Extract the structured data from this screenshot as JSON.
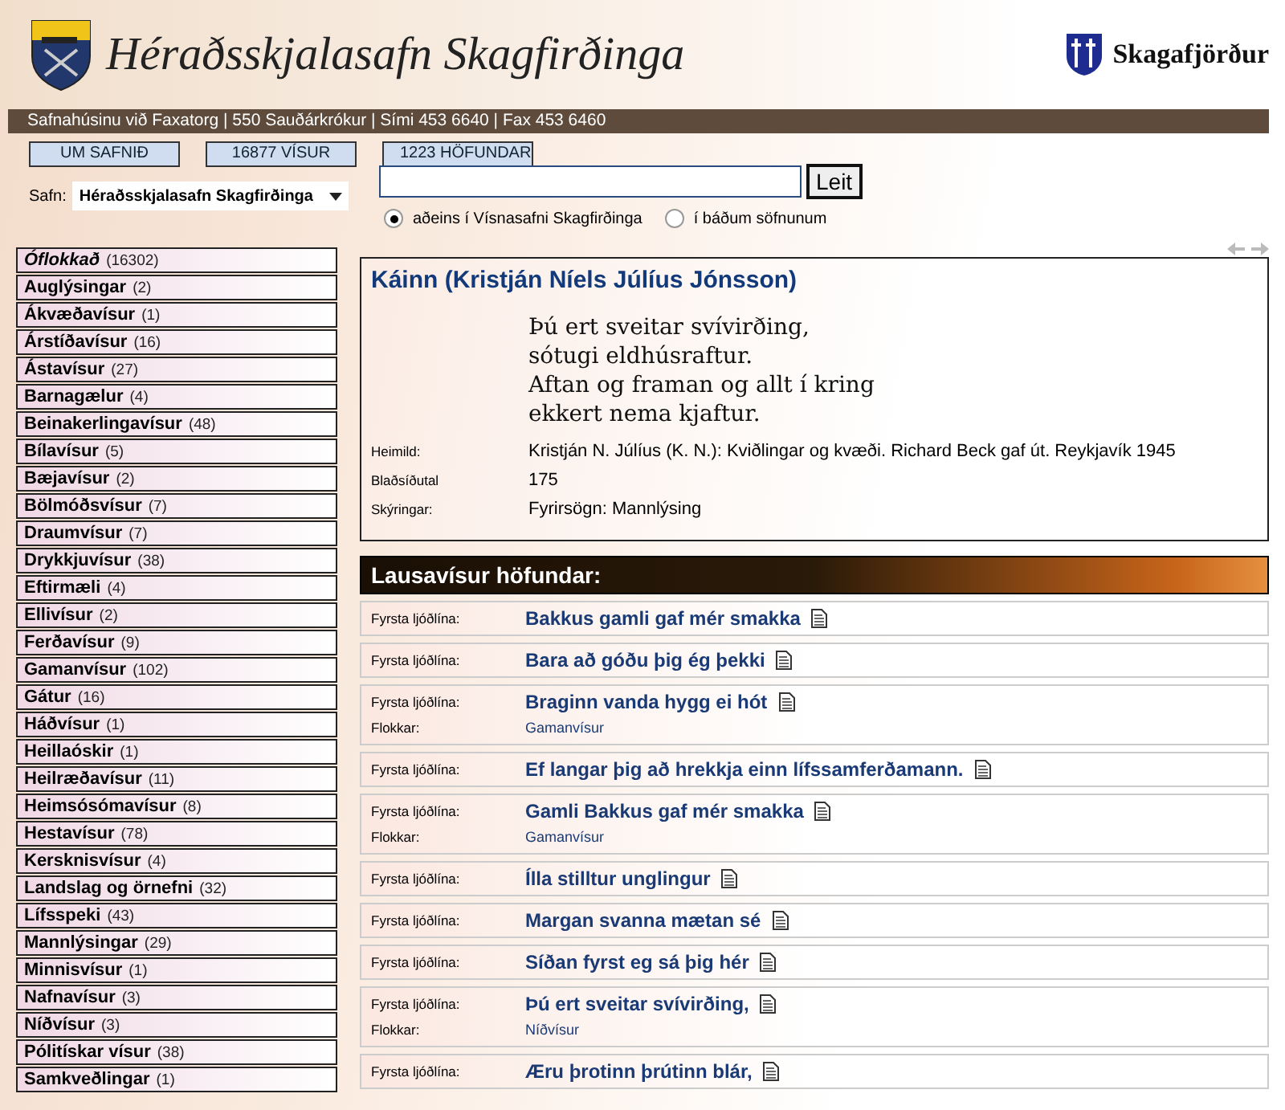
{
  "header": {
    "title": "Héraðsskjalasafn Skagfirðinga",
    "partner": "Skagafjörður",
    "address": "Safnahúsinu við Faxatorg | 550 Sauðárkrókur | Sími 453 6640 | Fax 453 6460"
  },
  "nav": [
    "UM SAFNIÐ",
    "16877 VÍSUR",
    "1223 HÖFUNDAR"
  ],
  "archive": {
    "label": "Safn:",
    "value": "Héraðsskjalasafn Skagfirðinga"
  },
  "search": {
    "button": "Leit"
  },
  "scope": [
    {
      "label": "aðeins í Vísnasafni Skagfirðinga",
      "selected": true
    },
    {
      "label": "í báðum söfnunum",
      "selected": false
    }
  ],
  "categories": [
    {
      "name": "Óflokkað",
      "count": "(16302)",
      "kind": "uncategorized"
    },
    {
      "name": "Auglýsingar",
      "count": "(2)",
      "kind": "category"
    },
    {
      "name": "Ákvæðavísur",
      "count": "(1)",
      "kind": "category"
    },
    {
      "name": "Árstíðavísur",
      "count": "(16)",
      "kind": "category"
    },
    {
      "name": "Ástavísur",
      "count": "(27)",
      "kind": "category"
    },
    {
      "name": "Barnagælur",
      "count": "(4)",
      "kind": "category"
    },
    {
      "name": "Beinakerlingavísur",
      "count": "(48)",
      "kind": "category"
    },
    {
      "name": "Bílavísur",
      "count": "(5)",
      "kind": "category"
    },
    {
      "name": "Bæjavísur",
      "count": "(2)",
      "kind": "category"
    },
    {
      "name": "Bölmóðsvísur",
      "count": "(7)",
      "kind": "category"
    },
    {
      "name": "Draumvísur",
      "count": "(7)",
      "kind": "category"
    },
    {
      "name": "Drykkjuvísur",
      "count": "(38)",
      "kind": "category"
    },
    {
      "name": "Eftirmæli",
      "count": "(4)",
      "kind": "category"
    },
    {
      "name": "Ellivísur",
      "count": "(2)",
      "kind": "category"
    },
    {
      "name": "Ferðavísur",
      "count": "(9)",
      "kind": "category"
    },
    {
      "name": "Gamanvísur",
      "count": "(102)",
      "kind": "category"
    },
    {
      "name": "Gátur",
      "count": "(16)",
      "kind": "category"
    },
    {
      "name": "Háðvísur",
      "count": "(1)",
      "kind": "category"
    },
    {
      "name": "Heillaóskir",
      "count": "(1)",
      "kind": "category"
    },
    {
      "name": "Heilræðavísur",
      "count": "(11)",
      "kind": "category"
    },
    {
      "name": "Heimsósómavísur",
      "count": "(8)",
      "kind": "category"
    },
    {
      "name": "Hestavísur",
      "count": "(78)",
      "kind": "category"
    },
    {
      "name": "Kersknisvísur",
      "count": "(4)",
      "kind": "category"
    },
    {
      "name": "Landslag og örnefni",
      "count": "(32)",
      "kind": "category"
    },
    {
      "name": "Lífsspeki",
      "count": "(43)",
      "kind": "category"
    },
    {
      "name": "Mannlýsingar",
      "count": "(29)",
      "kind": "category"
    },
    {
      "name": "Minnisvísur",
      "count": "(1)",
      "kind": "category"
    },
    {
      "name": "Nafnavísur",
      "count": "(3)",
      "kind": "category"
    },
    {
      "name": "Níðvísur",
      "count": "(3)",
      "kind": "category"
    },
    {
      "name": "Pólitískar vísur",
      "count": "(38)",
      "kind": "category"
    },
    {
      "name": "Samkveðlingar",
      "count": "(1)",
      "kind": "category"
    }
  ],
  "verse": {
    "author": "Káinn (Kristján Níels Júlíus Jónsson)",
    "lines": [
      "Þú ert sveitar svívirðing,",
      "sótugi eldhúsraftur.",
      "Aftan og framan og allt í kring",
      "ekkert nema kjaftur."
    ],
    "fields": [
      {
        "label": "Heimild:",
        "value": "Kristján N. Júlíus (K. N.): Kviðlingar og kvæði. Richard Beck gaf út. Reykjavík 1945"
      },
      {
        "label": "Blaðsíðutal",
        "value": "175"
      },
      {
        "label": "Skýringar:",
        "value": "Fyrirsögn: Mannlýsing"
      }
    ]
  },
  "list": {
    "title": "Lausavísur höfundar:",
    "rows": [
      {
        "label": "Fyrsta ljóðlína:",
        "first_line": "Bakkus gamli gaf mér smakka"
      },
      {
        "label": "Fyrsta ljóðlína:",
        "first_line": "Bara að góðu þig ég þekki"
      },
      {
        "label": "Fyrsta ljóðlína:",
        "first_line": "Braginn vanda hygg ei hót",
        "category_label": "Flokkar:",
        "category": "Gamanvísur"
      },
      {
        "label": "Fyrsta ljóðlína:",
        "first_line": "Ef langar þig að hrekkja einn lífssamferðamann."
      },
      {
        "label": "Fyrsta ljóðlína:",
        "first_line": "Gamli Bakkus gaf mér smakka",
        "category_label": "Flokkar:",
        "category": "Gamanvísur"
      },
      {
        "label": "Fyrsta ljóðlína:",
        "first_line": "Ílla stilltur unglingur"
      },
      {
        "label": "Fyrsta ljóðlína:",
        "first_line": "Margan svanna mætan sé"
      },
      {
        "label": "Fyrsta ljóðlína:",
        "first_line": "Síðan fyrst eg sá þig hér"
      },
      {
        "label": "Fyrsta ljóðlína:",
        "first_line": "Þú ert sveitar svívirðing,",
        "category_label": "Flokkar:",
        "category": "Níðvísur"
      },
      {
        "label": "Fyrsta ljóðlína:",
        "first_line": "Æru þrotinn þrútinn blár,"
      }
    ]
  }
}
